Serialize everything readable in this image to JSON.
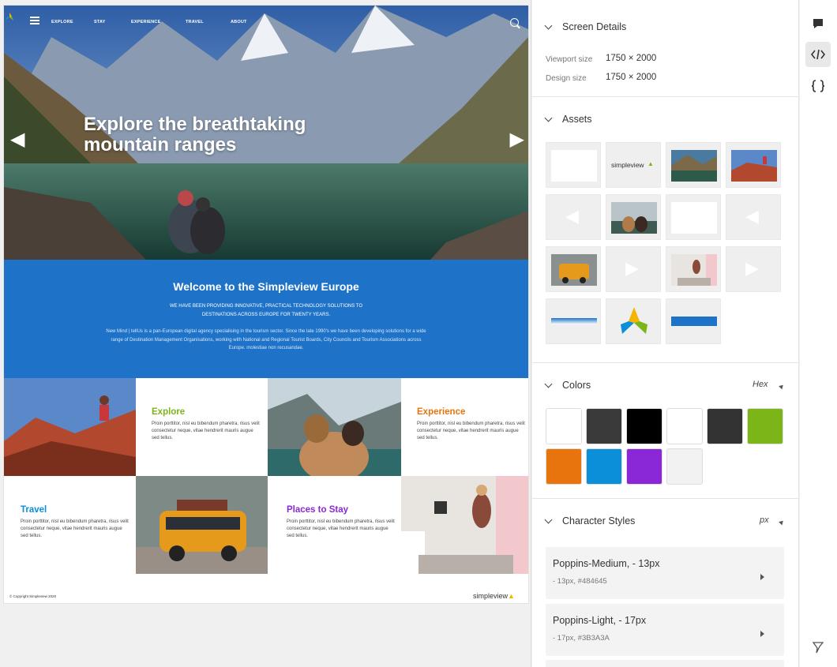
{
  "site": {
    "nav": [
      "EXPLORE",
      "STAY",
      "EXPERIENCE",
      "TRAVEL",
      "ABOUT"
    ],
    "hero_title": "Explore the breathtaking mountain ranges",
    "welcome_title": "Welcome to the Simpleview Europe",
    "welcome_sub": "WE HAVE BEEN PROVIDING INNOVATIVE, PRACTICAL TECHNOLOGY SOLUTIONS TO DESTINATIONS ACROSS EUROPE FOR TWENTY YEARS.",
    "welcome_body": "New Mind | tellUs is a pan-European digital agency specialising in the tourism sector. Since the late 1990's we have been developing solutions for a wide range of Destination Management Organisations, working with National and Regional Tourist Boards, City Councils and Tourism Associations across Europe. molestiae non recusandae.",
    "tiles": [
      {
        "title": "Explore",
        "text": "Proin porttitor, nisl eu bibendum pharetra, risus velit consectetur neque, vitae hendrerit mauris augue sed tellus.",
        "color": "#7cb517"
      },
      {
        "title": "Experience",
        "text": "Proin porttitor, nisl eu bibendum pharetra, risus velit consectetur neque, vitae hendrerit mauris augue sed tellus.",
        "color": "#e8740e"
      },
      {
        "title": "Travel",
        "text": "Proin porttitor, nisl eu bibendum pharetra, risus velit consectetur neque, vitae hendrerit mauris augue sed tellus.",
        "color": "#0c8fd9"
      },
      {
        "title": "Places to Stay",
        "text": "Proin porttitor, nisl eu bibendum pharetra, risus velit consectetur neque, vitae hendrerit mauris augue sed tellus.",
        "color": "#8a27d6"
      }
    ],
    "copyright": "© Copyright Simpleview 2020",
    "footer_logo": "simpleview"
  },
  "panel": {
    "screen_details": {
      "title": "Screen Details",
      "viewport_label": "Viewport size",
      "viewport_value": "1750 × 2000",
      "design_label": "Design size",
      "design_value": "1750 × 2000"
    },
    "assets": {
      "title": "Assets",
      "logo_text": "simpleview"
    },
    "colors": {
      "title": "Colors",
      "format": "Hex",
      "swatches": [
        "#ffffff",
        "#3b3a3a",
        "#000000",
        "#ffffff",
        "#333333",
        "#7cb517",
        "#e8740e",
        "#0c8fd9",
        "#8a27d6",
        "#f2f2f2"
      ]
    },
    "character_styles": {
      "title": "Character Styles",
      "unit": "px",
      "items": [
        {
          "name": "Poppins-Medium, - 13px",
          "meta": "- 13px, #484645"
        },
        {
          "name": "Poppins-Light, - 17px",
          "meta": "- 17px, #3B3A3A"
        }
      ]
    }
  },
  "toolbar": {
    "comment_icon": "comment-icon",
    "code_icon": "code-icon",
    "json_icon": "json-icon",
    "flag_icon": "flag-icon"
  }
}
